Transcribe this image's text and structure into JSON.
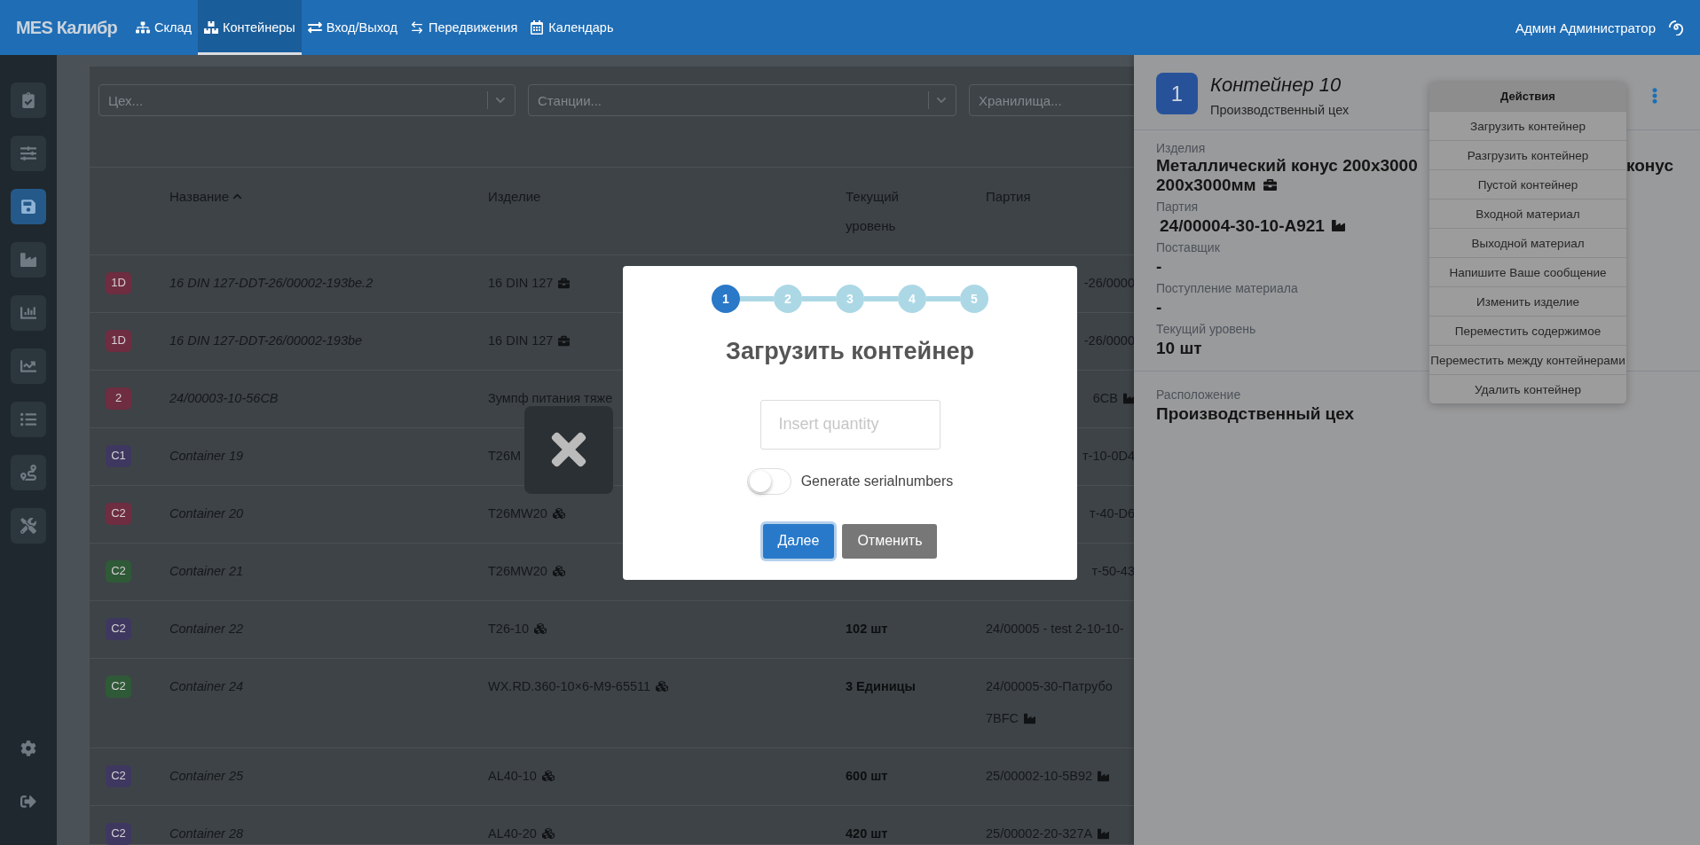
{
  "top_bar": {
    "logo": "MES Калибр",
    "nav": [
      {
        "label": "Склад",
        "selected": false
      },
      {
        "label": "Контейнеры",
        "selected": true
      },
      {
        "label": "Вход/Выход",
        "selected": false
      },
      {
        "label": "Передвижения",
        "selected": false
      },
      {
        "label": "Календарь",
        "selected": false
      }
    ],
    "user": "Админ Администратор"
  },
  "sidebar": {
    "items": [
      {
        "selected": false
      },
      {
        "selected": false
      },
      {
        "selected": true
      },
      {
        "selected": false
      },
      {
        "selected": false
      },
      {
        "selected": false
      },
      {
        "selected": false
      },
      {
        "selected": false
      },
      {
        "selected": false
      }
    ],
    "bottom_items": [
      {
        "selected": false
      },
      {
        "selected": false
      }
    ]
  },
  "filters": [
    {
      "placeholder": "Цех..."
    },
    {
      "placeholder": "Станции..."
    },
    {
      "placeholder": "Хранилища..."
    }
  ],
  "table": {
    "columns": [
      {
        "label": "Название",
        "sorted": true
      },
      {
        "label": "Изделие",
        "sorted": false
      },
      {
        "label": "Текущий уровень",
        "sorted": false
      },
      {
        "label": "Партия",
        "sorted": false
      }
    ],
    "rows": [
      {
        "badge": "1D",
        "color": "#6e2d40",
        "name": "16 DIN 127-DDT-26/00002-193be.2",
        "product": "16 DIN 127",
        "kind": "brick",
        "level": "",
        "batch": [
          "-26/0000"
        ],
        "batch_mark": false
      },
      {
        "badge": "1D",
        "color": "#6e2d40",
        "name": "16 DIN 127-DDT-26/00002-193be",
        "product": "16 DIN 127",
        "kind": "brick",
        "level": "",
        "batch": [
          "-26/0000"
        ],
        "batch_mark": false
      },
      {
        "badge": "2",
        "color": "#6e2d40",
        "name": "24/00003-10-56CB",
        "product": "Зумпф питания тяже",
        "kind": "none",
        "level": "",
        "batch": [
          "6CB"
        ],
        "batch_mark": true
      },
      {
        "badge": "C1",
        "color": "#3e3860",
        "name": "Container 19",
        "product": "T26M",
        "kind": "none",
        "level": "",
        "batch": [
          "т-10-0D4"
        ],
        "batch_mark": false
      },
      {
        "badge": "C2",
        "color": "#6e2d40",
        "name": "Container 20",
        "product": "T26MW20",
        "kind": "cubes",
        "level": "",
        "batch": [
          "т-40-D6"
        ],
        "batch_mark": false
      },
      {
        "badge": "C2",
        "color": "#2f5a37",
        "name": "Container 21",
        "product": "T26MW20",
        "kind": "cubes",
        "level": "",
        "batch": [
          "т-50-43"
        ],
        "batch_mark": false
      },
      {
        "badge": "C2",
        "color": "#3e3860",
        "name": "Container 22",
        "product": "T26-10",
        "kind": "cubes",
        "level": "102 шт",
        "batch": [
          "24/00005 - test 2-10-10-"
        ],
        "batch_mark": false
      },
      {
        "badge": "C2",
        "color": "#2f5a37",
        "name": "Container 24",
        "product": "WX.RD.360-10×6-M9-65511",
        "kind": "cubes",
        "level": "3 Единицы",
        "batch": [
          "24/00005-30-Патрубо",
          "7BFC"
        ],
        "batch_mark": true
      },
      {
        "badge": "C2",
        "color": "#3e3860",
        "name": "Container 25",
        "product": "AL40-10",
        "kind": "cubes",
        "level": "600 шт",
        "batch": [
          "25/00002-10-5B92"
        ],
        "batch_mark": true
      },
      {
        "badge": "C2",
        "color": "#3e3860",
        "name": "Container 28",
        "product": "AL40-20",
        "kind": "cubes",
        "level": "420 шт",
        "batch": [
          "25/00002-20-327A"
        ],
        "batch_mark": true
      }
    ]
  },
  "panel": {
    "badge": "1",
    "title": "Контейнер 10",
    "subtitle": "Производственный цех",
    "fields": [
      {
        "kind": "split",
        "label": "Изделия",
        "parts": [
          "Металлический конус 200x3000",
          "конус",
          "200x3000мм"
        ]
      },
      {
        "kind": "batch",
        "label": "Партия",
        "value": "24/00004-30-10-A921"
      },
      {
        "kind": "plain",
        "label": "Поставщик",
        "value": "-"
      },
      {
        "kind": "plain",
        "label": "Поступление материала",
        "value": "-"
      },
      {
        "kind": "plain",
        "label": "Текущий уровень",
        "value": "10 шт"
      },
      {
        "kind": "section",
        "label": "Расположение",
        "value": "Производственный цех"
      }
    ],
    "menu": {
      "header": "Действия",
      "items": [
        "Загрузить контейнер",
        "Разгрузить контейнер",
        "Пустой контейнер",
        "Входной материал",
        "Выходной материал",
        "Напишите Ваше сообщение",
        "Изменить изделие",
        "Переместить содержимое",
        "Переместить между контейнерами",
        "Удалить контейнер"
      ]
    }
  },
  "modal": {
    "steps": [
      {
        "label": "1",
        "selected": true
      },
      {
        "label": "2",
        "selected": false
      },
      {
        "label": "3",
        "selected": false
      },
      {
        "label": "4",
        "selected": false
      },
      {
        "label": "5",
        "selected": false
      }
    ],
    "title": "Загрузить контейнер",
    "quantity": {
      "placeholder": "Insert quantity"
    },
    "toggle": {
      "label": "Generate serialnumbers",
      "on": false
    },
    "buttons": [
      {
        "label": "Далее",
        "kind": "primary"
      },
      {
        "label": "Отменить",
        "kind": "secondary"
      }
    ]
  }
}
